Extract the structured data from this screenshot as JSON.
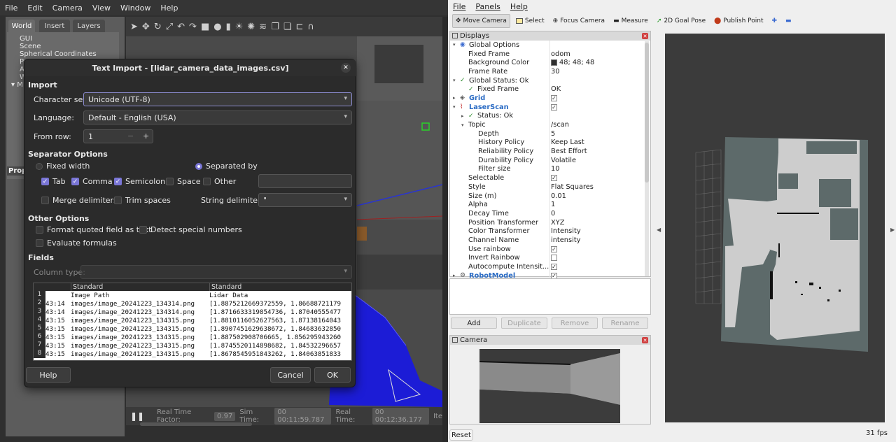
{
  "gazebo": {
    "menu": [
      "File",
      "Edit",
      "Camera",
      "View",
      "Window",
      "Help"
    ],
    "tabs": [
      "World",
      "Insert",
      "Layers"
    ],
    "tree": [
      "GUI",
      "Scene",
      "Spherical Coordinates",
      "P",
      "A",
      "W",
      "M"
    ],
    "prop_label": "Prop",
    "real_time_factor_label": "Real Time Factor:",
    "real_time_factor": "0.97",
    "sim_time_label": "Sim Time:",
    "sim_time": "00 00:11:59.787",
    "real_time_label": "Real Time:",
    "real_time": "00 00:12:36.177",
    "iter_label": "Ite"
  },
  "dialog": {
    "title": "Text Import - [lidar_camera_data_images.csv]",
    "import_label": "Import",
    "charset_label": "Character set:",
    "charset": "Unicode (UTF-8)",
    "language_label": "Language:",
    "language": "Default - English (USA)",
    "from_row_label": "From row:",
    "from_row": "1",
    "sep_label": "Separator Options",
    "fixed_width": "Fixed width",
    "separated_by": "Separated by",
    "tab": "Tab",
    "comma": "Comma",
    "semicolon": "Semicolon",
    "space": "Space",
    "other": "Other",
    "merge": "Merge delimiters",
    "trim": "Trim spaces",
    "string_delim_label": "String delimiter:",
    "string_delim": "\"",
    "other_options": "Other Options",
    "format_quoted": "Format quoted field as text",
    "detect_special": "Detect special numbers",
    "eval_formulas": "Evaluate formulas",
    "fields_label": "Fields",
    "column_type_label": "Column type:",
    "col_headers": [
      "Standard",
      "Standard"
    ],
    "rows": [
      [
        "1",
        "",
        "Image Path",
        "Lidar Data"
      ],
      [
        "2",
        "43:14",
        "images/image_20241223_134314.png",
        "[1.8875212669372559, 1.86688721179"
      ],
      [
        "3",
        "43:14",
        "images/image_20241223_134314.png",
        "[1.8716633319854736, 1.87040555477"
      ],
      [
        "4",
        "43:15",
        "images/image_20241223_134315.png",
        "[1.8810116052627563, 1.87138164043"
      ],
      [
        "5",
        "43:15",
        "images/image_20241223_134315.png",
        "[1.8907451629638672, 1.84683632850"
      ],
      [
        "6",
        "43:15",
        "images/image_20241223_134315.png",
        "[1.887502908706665, 1.856295943260"
      ],
      [
        "7",
        "43:15",
        "images/image_20241223_134315.png",
        "[1.8745520114898682, 1.84532296657"
      ],
      [
        "8",
        "43:15",
        "images/image_20241223_134315.png",
        "[1.8678545951843262, 1.84063851833"
      ]
    ],
    "help": "Help",
    "cancel": "Cancel",
    "ok": "OK"
  },
  "rviz": {
    "menu": [
      "File",
      "Panels",
      "Help"
    ],
    "tools": [
      "Move Camera",
      "Select",
      "Focus Camera",
      "Measure",
      "2D Goal Pose",
      "Publish Point"
    ],
    "displays_title": "Displays",
    "props": [
      {
        "k": "Global Options",
        "v": "",
        "lvl": 1,
        "exp": "v",
        "icon": "globe"
      },
      {
        "k": "Fixed Frame",
        "v": "odom",
        "lvl": 2
      },
      {
        "k": "Background Color",
        "v": "48; 48; 48",
        "lvl": 2,
        "swatch": "#303030"
      },
      {
        "k": "Frame Rate",
        "v": "30",
        "lvl": 2
      },
      {
        "k": "Global Status: Ok",
        "v": "",
        "lvl": 1,
        "exp": "v",
        "icon": "check"
      },
      {
        "k": "Fixed Frame",
        "v": "OK",
        "lvl": 2,
        "icon": "check"
      },
      {
        "k": "Grid",
        "v": "",
        "lvl": 1,
        "exp": ">",
        "icon": "grid",
        "blue": true,
        "cb": true
      },
      {
        "k": "LaserScan",
        "v": "",
        "lvl": 1,
        "exp": "v",
        "icon": "laser",
        "blue": true,
        "cb": true
      },
      {
        "k": "Status: Ok",
        "v": "",
        "lvl": 2,
        "exp": ">",
        "icon": "check"
      },
      {
        "k": "Topic",
        "v": "/scan",
        "lvl": 2,
        "exp": "v"
      },
      {
        "k": "Depth",
        "v": "5",
        "lvl": 3
      },
      {
        "k": "History Policy",
        "v": "Keep Last",
        "lvl": 3
      },
      {
        "k": "Reliability Policy",
        "v": "Best Effort",
        "lvl": 3
      },
      {
        "k": "Durability Policy",
        "v": "Volatile",
        "lvl": 3
      },
      {
        "k": "Filter size",
        "v": "10",
        "lvl": 3
      },
      {
        "k": "Selectable",
        "v": "",
        "lvl": 2,
        "cb": true
      },
      {
        "k": "Style",
        "v": "Flat Squares",
        "lvl": 2
      },
      {
        "k": "Size (m)",
        "v": "0.01",
        "lvl": 2
      },
      {
        "k": "Alpha",
        "v": "1",
        "lvl": 2
      },
      {
        "k": "Decay Time",
        "v": "0",
        "lvl": 2
      },
      {
        "k": "Position Transformer",
        "v": "XYZ",
        "lvl": 2
      },
      {
        "k": "Color Transformer",
        "v": "Intensity",
        "lvl": 2
      },
      {
        "k": "Channel Name",
        "v": "intensity",
        "lvl": 2
      },
      {
        "k": "Use rainbow",
        "v": "",
        "lvl": 2,
        "cb": true
      },
      {
        "k": "Invert Rainbow",
        "v": "",
        "lvl": 2,
        "cb": false
      },
      {
        "k": "Autocompute Intensit...",
        "v": "",
        "lvl": 2,
        "cb": true
      },
      {
        "k": "RobotModel",
        "v": "",
        "lvl": 1,
        "exp": ">",
        "icon": "robot",
        "blue": true,
        "cb": true
      }
    ],
    "add": "Add",
    "duplicate": "Duplicate",
    "remove": "Remove",
    "rename": "Rename",
    "camera_title": "Camera",
    "reset": "Reset",
    "fps": "31 fps"
  }
}
